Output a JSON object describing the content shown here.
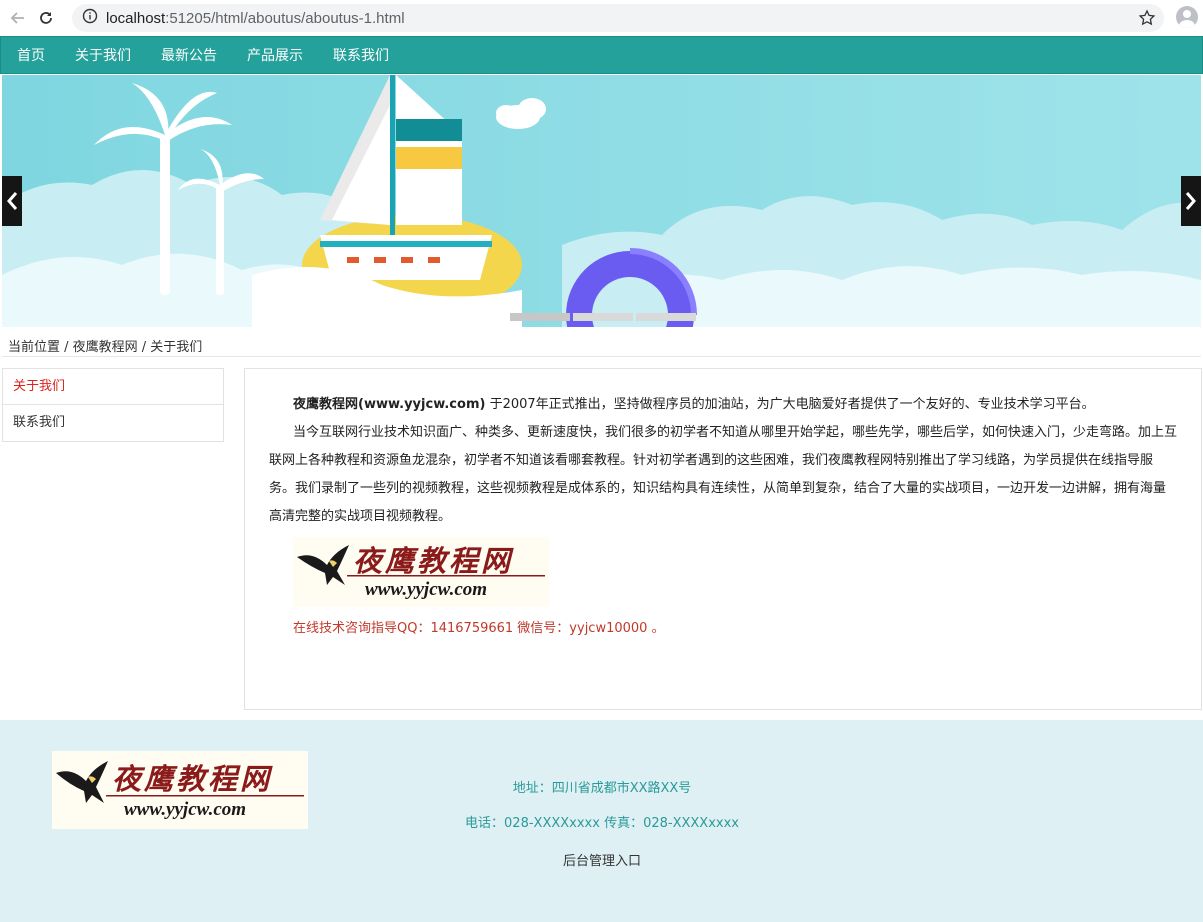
{
  "browser": {
    "url_host": "localhost",
    "url_path": ":51205/html/aboutus/aboutus-1.html"
  },
  "nav": {
    "items": [
      "首页",
      "关于我们",
      "最新公告",
      "产品展示",
      "联系我们"
    ]
  },
  "breadcrumb": "当前位置 / 夜鹰教程网 / 关于我们",
  "sidebar": {
    "items": [
      {
        "label": "关于我们",
        "active": true
      },
      {
        "label": "联系我们",
        "active": false
      }
    ]
  },
  "content": {
    "brand": "夜鹰教程网(www.yyjcw.com)",
    "intro_rest": " 于2007年正式推出，坚持做程序员的加油站，为广大电脑爱好者提供了一个友好的、专业技术学习平台。",
    "paragraph2": "当今互联网行业技术知识面广、种类多、更新速度快，我们很多的初学者不知道从哪里开始学起，哪些先学，哪些后学，如何快速入门，少走弯路。加上互联网上各种教程和资源鱼龙混杂，初学者不知道该看哪套教程。针对初学者遇到的这些困难，我们夜鹰教程网特别推出了学习线路，为学员提供在线指导服务。我们录制了一些列的视频教程，这些视频教程是成体系的，知识结构具有连续性，从简单到复杂，结合了大量的实战项目，一边开发一边讲解，拥有海量高清完整的实战项目视频教程。",
    "contact": "在线技术咨询指导QQ：1416759661 微信号：yyjcw10000 。"
  },
  "logo": {
    "title": "夜鹰教程网",
    "url": "www.yyjcw.com"
  },
  "footer": {
    "address": "地址：四川省成都市XX路XX号",
    "phone": "电话：028-XXXXxxxx 传真：028-XXXXxxxx",
    "admin": "后台管理入口"
  },
  "colors": {
    "nav_bg": "#23a19a",
    "active_red": "#d9241f",
    "footer_bg": "#dff0f4",
    "footer_text": "#2a9a99"
  }
}
